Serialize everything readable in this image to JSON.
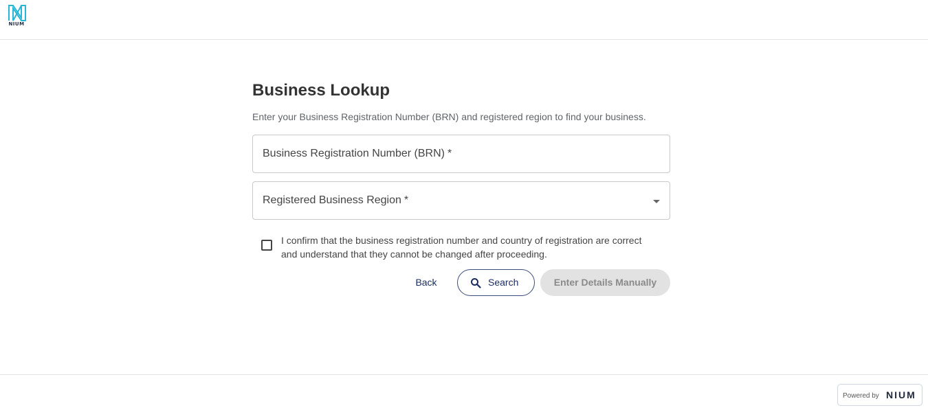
{
  "brand": {
    "logo_text": "NIUM",
    "accent_color": "#29b6d6"
  },
  "page": {
    "title": "Business Lookup",
    "subtitle": "Enter your Business Registration Number (BRN) and registered region to find your business."
  },
  "form": {
    "brn_label": "Business Registration Number (BRN)",
    "brn_required": "*",
    "region_label": "Registered Business Region",
    "region_required": "*",
    "region_icon": "chevron-down-icon",
    "confirm_checked": false,
    "confirm_text_line1": "I confirm that the business registration number and country of registration are correct",
    "confirm_text_line2": "and understand that they cannot be changed after proceeding."
  },
  "actions": {
    "back_label": "Back",
    "search_label": "Search",
    "search_icon": "search-icon",
    "manual_label": "Enter Details Manually",
    "manual_enabled": false
  },
  "footer": {
    "powered_by_label": "Powered by",
    "powered_by_brand": "NIUM"
  }
}
